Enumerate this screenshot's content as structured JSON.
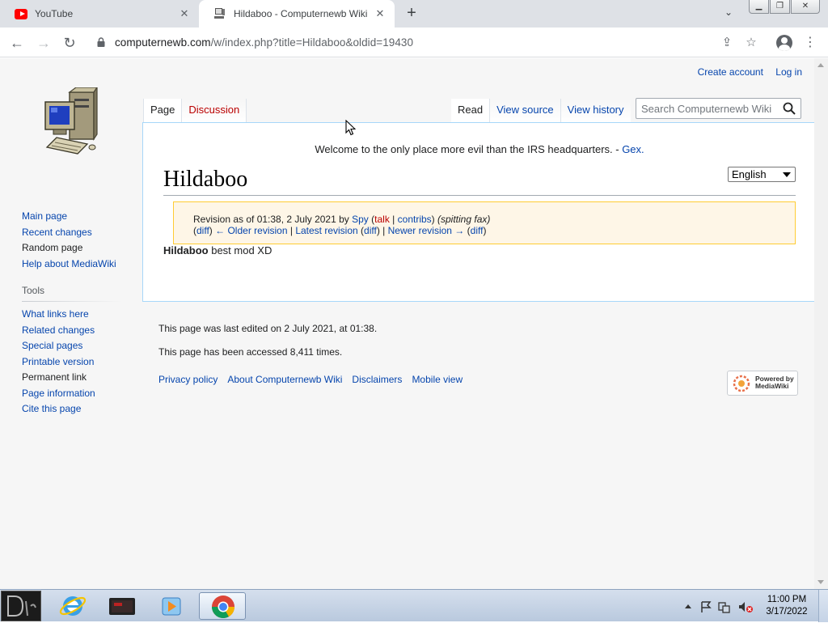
{
  "browser": {
    "tabs": [
      {
        "title": "YouTube",
        "close": "✕"
      },
      {
        "title": "Hildaboo - Computernewb Wiki",
        "close": "✕"
      }
    ],
    "new_tab": "+",
    "url_host": "computernewb.com",
    "url_path": "/w/index.php?title=Hildaboo&oldid=19430"
  },
  "wiki": {
    "personal": {
      "create_account": "Create account",
      "log_in": "Log in"
    },
    "tabs_left": [
      {
        "label": "Page"
      },
      {
        "label": "Discussion"
      }
    ],
    "tabs_right": [
      {
        "label": "Read"
      },
      {
        "label": "View source"
      },
      {
        "label": "View history"
      }
    ],
    "search_placeholder": "Search Computernewb Wiki",
    "navigation": [
      "Main page",
      "Recent changes",
      "Random page",
      "Help about MediaWiki"
    ],
    "tools_heading": "Tools",
    "tools": [
      "What links here",
      "Related changes",
      "Special pages",
      "Printable version",
      "Permanent link",
      "Page information",
      "Cite this page"
    ],
    "sitenotice": {
      "text": "Welcome to the only place more evil than the IRS headquarters. - ",
      "link": "Gex."
    },
    "language": "English",
    "title": "Hildaboo",
    "revision": {
      "prefix": "Revision as of 01:38, 2 July 2021 by ",
      "user": "Spy",
      "talk": "talk",
      "contribs": "contribs",
      "summary": "(spitting fax)",
      "diff": "diff",
      "older": "← Older revision",
      "latest": "Latest revision",
      "newer": "Newer revision →"
    },
    "body": {
      "bold": "Hildaboo",
      "rest": " best mod XD"
    },
    "footer": {
      "last_edited": "This page was last edited on 2 July 2021, at 01:38.",
      "accessed": "This page has been accessed 8,411 times.",
      "links": [
        "Privacy policy",
        "About Computernewb Wiki",
        "Disclaimers",
        "Mobile view"
      ]
    },
    "powered_by": {
      "line1": "Powered by",
      "line2": "MediaWiki"
    }
  },
  "taskbar": {
    "clock_time": "11:00 PM",
    "clock_date": "3/17/2022"
  },
  "colors": {
    "link": "#0645ad",
    "redlink": "#ba0000",
    "revbox_bg": "#fef6e7",
    "revbox_border": "#ffcc33"
  }
}
